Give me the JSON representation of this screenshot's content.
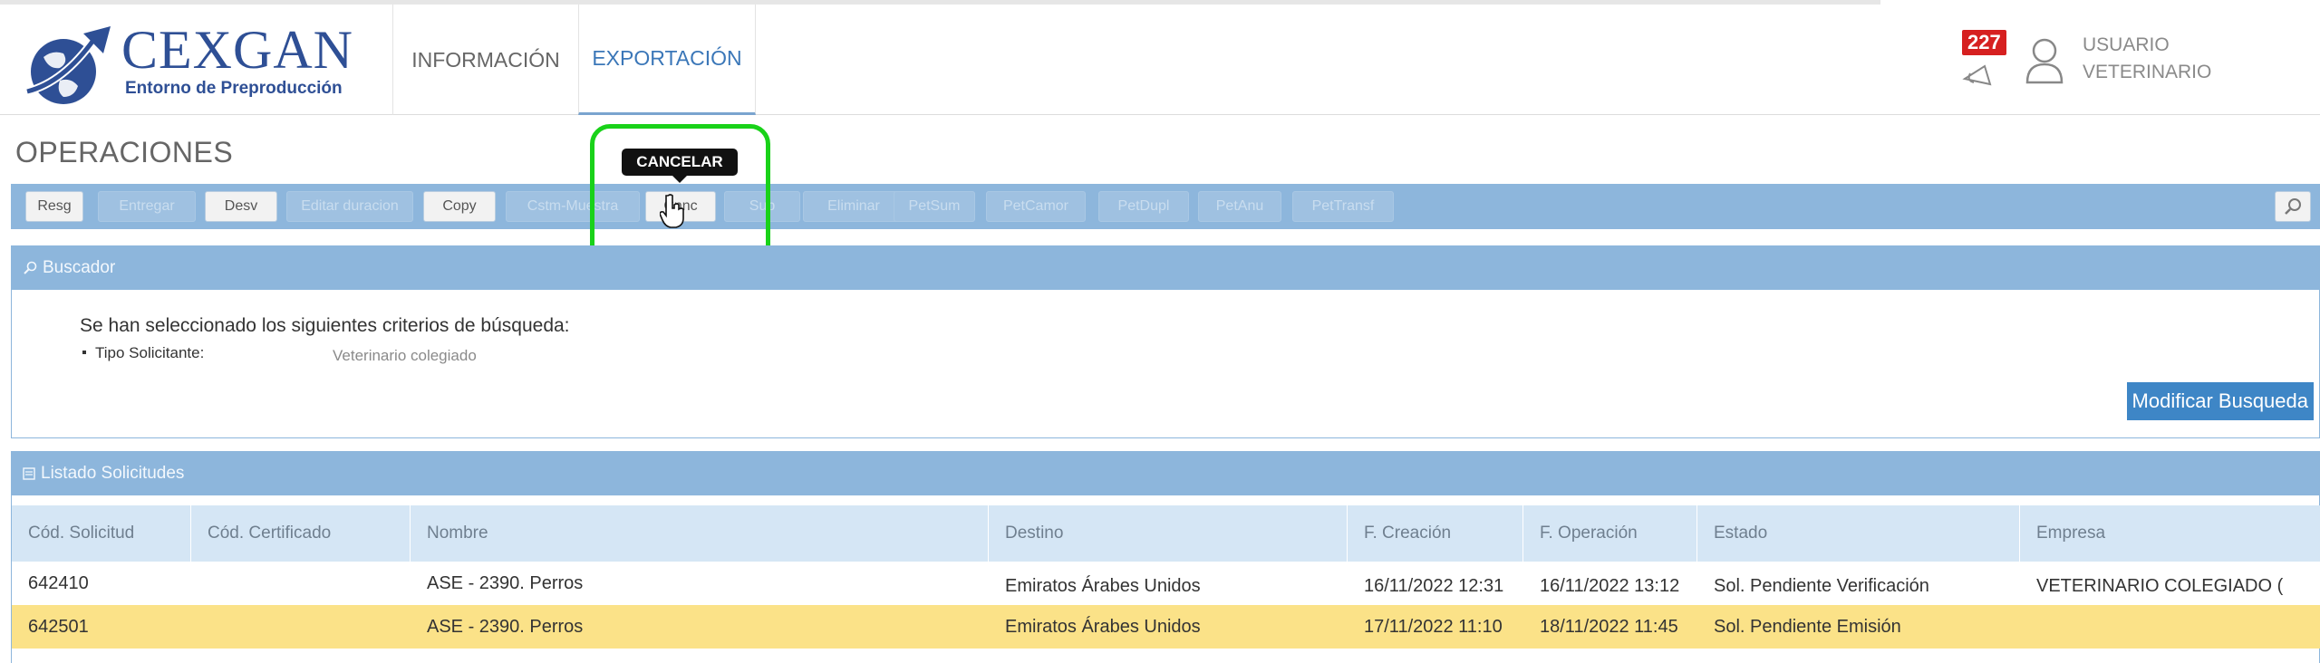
{
  "brand": {
    "title": "CEXGAN",
    "subtitle": "Entorno de Preproducción",
    "colors": {
      "brand_blue": "#2e4f95",
      "accent_blue": "#3b77b8",
      "toolbar_blue": "#8db6dc",
      "highlight_green": "#19d219",
      "selected_row": "#fbe288"
    }
  },
  "nav": {
    "tabs": [
      {
        "label": "INFORMACIÓN"
      },
      {
        "label": "EXPORTACIÓN",
        "active": true
      }
    ]
  },
  "header": {
    "notification_count": "227",
    "user_line1": "USUARIO",
    "user_line2": "VETERINARIO",
    "icons": [
      "bell-icon",
      "user-icon"
    ]
  },
  "page": {
    "title": "OPERACIONES"
  },
  "toolbar": {
    "buttons": [
      {
        "label": "Resg",
        "enabled": true
      },
      {
        "label": "Entregar",
        "enabled": false
      },
      {
        "label": "Desv",
        "enabled": true
      },
      {
        "label": "Editar duracion",
        "enabled": false
      },
      {
        "label": "Copy",
        "enabled": true
      },
      {
        "label": "Cstm-Muestra",
        "enabled": false
      },
      {
        "label": "Cnnc",
        "enabled": true
      },
      {
        "label": "Sub",
        "enabled": false
      },
      {
        "label": "Eliminar",
        "enabled": false
      },
      {
        "label": "PetSum",
        "enabled": false
      },
      {
        "label": "PetCamor",
        "enabled": false
      },
      {
        "label": "PetDupl",
        "enabled": false
      },
      {
        "label": "PetAnu",
        "enabled": false
      },
      {
        "label": "PetTransf",
        "enabled": false
      }
    ],
    "tooltip": "CANCELAR"
  },
  "buscador": {
    "header": "Buscador",
    "criteria_title": "Se han seleccionado los siguientes criterios de búsqueda:",
    "criteria_label": "Tipo Solicitante:",
    "criteria_value": "Veterinario colegiado",
    "modify_button": "Modificar Busqueda"
  },
  "listado": {
    "header": "Listado Solicitudes",
    "columns": [
      "Cód. Solicitud",
      "Cód. Certificado",
      "Nombre",
      "Destino",
      "F. Creación",
      "F. Operación",
      "Estado",
      "Empresa"
    ],
    "rows": [
      [
        "642410",
        "",
        "ASE - 2390. Perros",
        "Emiratos Árabes Unidos",
        "16/11/2022 12:31",
        "16/11/2022 13:12",
        "Sol. Pendiente Verificación",
        "VETERINARIO COLEGIADO ("
      ],
      [
        "642501",
        "",
        "ASE - 2390. Perros",
        "Emiratos Árabes Unidos",
        "17/11/2022 11:10",
        "18/11/2022 11:45",
        "Sol. Pendiente Emisión",
        ""
      ]
    ]
  }
}
